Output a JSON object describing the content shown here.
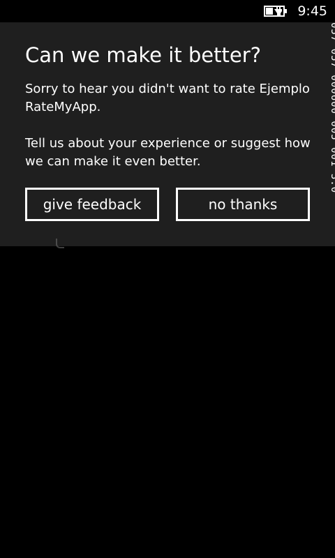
{
  "status_bar": {
    "time": "9:45",
    "battery_icon": "battery-charging-icon"
  },
  "dialog": {
    "title": "Can we make it better?",
    "message": "Sorry to hear you didn't want to rate Ejemplo RateMyApp.",
    "detail": "Tell us about your experience or suggest how we can make it even better.",
    "buttons": {
      "feedback_label": "give feedback",
      "no_thanks_label": "no thanks"
    }
  },
  "frame_counter": {
    "text": "057 057 000600 005 001 3.0 ̀"
  }
}
